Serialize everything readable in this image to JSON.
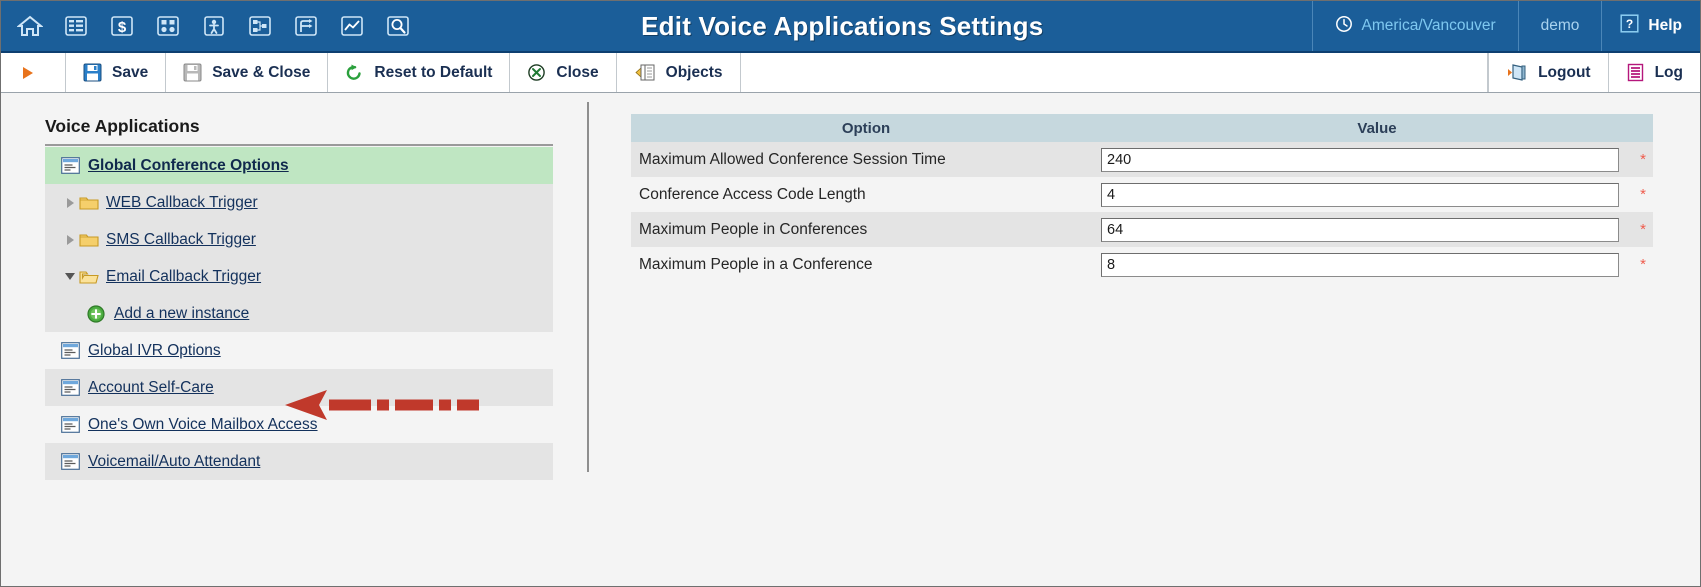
{
  "header": {
    "title": "Edit Voice Applications Settings",
    "nav_icons": [
      {
        "name": "home-icon",
        "label": "Home"
      },
      {
        "name": "list-icon",
        "label": "Lists"
      },
      {
        "name": "dollar-icon",
        "label": "Billing"
      },
      {
        "name": "grid-nodes-icon",
        "label": "Services"
      },
      {
        "name": "person-icon",
        "label": "Customers"
      },
      {
        "name": "network-icon",
        "label": "Network"
      },
      {
        "name": "routing-icon",
        "label": "Routing"
      },
      {
        "name": "chart-icon",
        "label": "Statistics"
      },
      {
        "name": "search-magnifier-icon",
        "label": "Search"
      }
    ],
    "timezone": "America/Vancouver",
    "user": "demo",
    "help": "Help"
  },
  "toolbar": {
    "play_label": "",
    "save": "Save",
    "save_close": "Save & Close",
    "reset": "Reset to Default",
    "close": "Close",
    "objects": "Objects",
    "logout": "Logout",
    "log": "Log"
  },
  "sidebar": {
    "title": "Voice Applications",
    "items": [
      {
        "label": "Global Conference Options",
        "icon": "options-page-icon",
        "type": "leaf",
        "state": "selected",
        "indent": 0
      },
      {
        "label": "WEB Callback Trigger",
        "icon": "folder-icon",
        "type": "group",
        "state": "collapsed",
        "indent": 0
      },
      {
        "label": "SMS Callback Trigger",
        "icon": "folder-icon",
        "type": "group",
        "state": "collapsed",
        "indent": 0
      },
      {
        "label": "Email Callback Trigger",
        "icon": "folder-open-icon",
        "type": "group",
        "state": "expanded",
        "indent": 0
      },
      {
        "label": "Add a new instance",
        "icon": "add-plus-icon",
        "type": "action",
        "state": "normal",
        "indent": 1
      },
      {
        "label": "Global IVR Options",
        "icon": "options-page-icon",
        "type": "leaf",
        "state": "normal",
        "indent": 0
      },
      {
        "label": "Account Self-Care",
        "icon": "options-page-icon",
        "type": "leaf",
        "state": "normal",
        "indent": 0
      },
      {
        "label": "One's Own Voice Mailbox Access",
        "icon": "options-page-icon",
        "type": "leaf",
        "state": "normal",
        "indent": 0
      },
      {
        "label": "Voicemail/Auto Attendant",
        "icon": "options-page-icon",
        "type": "leaf",
        "state": "normal",
        "indent": 0
      }
    ],
    "annotation": {
      "name": "red-dashed-arrow",
      "color": "#c0392b",
      "points_to": "Add a new instance"
    }
  },
  "settings": {
    "columns": [
      "Option",
      "Value"
    ],
    "required_marker": "*",
    "rows": [
      {
        "option": "Maximum Allowed Conference Session Time",
        "value": "240",
        "required": true
      },
      {
        "option": "Conference Access Code Length",
        "value": "4",
        "required": true
      },
      {
        "option": "Maximum People in Conferences",
        "value": "64",
        "required": true
      },
      {
        "option": "Maximum People in a Conference",
        "value": "8",
        "required": true
      }
    ]
  },
  "colors": {
    "header_blue": "#1b5e99",
    "selected_green": "#bfe6c2",
    "table_header": "#c6d8de",
    "link_blue": "#13315c",
    "annotation_red": "#c0392b",
    "required_red": "#ef5b4c"
  }
}
